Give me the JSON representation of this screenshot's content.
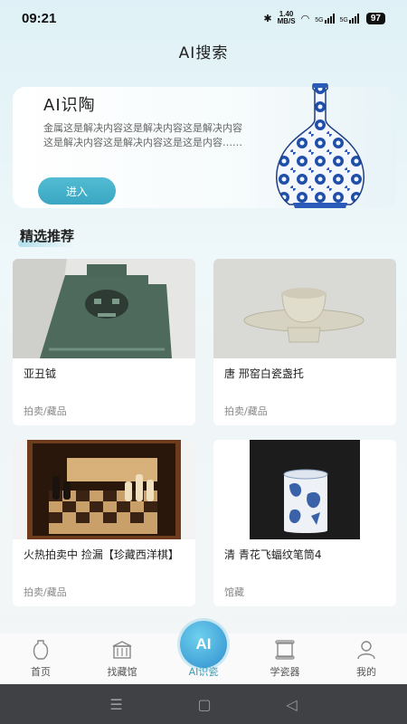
{
  "status": {
    "time": "09:21",
    "speed": "1.40",
    "speed_unit": "MB/S",
    "net1": "5G",
    "net2": "5G",
    "battery": "97"
  },
  "header": {
    "title": "AI搜索"
  },
  "ai_card": {
    "title": "AI识陶",
    "description": "金属这是解决内容这是解决内容这是解决内容这是解决内容这是解决内容这是这是内容……",
    "button": "进入"
  },
  "section": {
    "title": "精选推荐"
  },
  "items": [
    {
      "name": "亚丑钺",
      "tag": "拍卖/藏品",
      "image": "bronze-axe-image"
    },
    {
      "name": "唐 邢窑白瓷盏托",
      "tag": "拍卖/藏品",
      "image": "white-porcelain-cup-image"
    },
    {
      "name": "火热拍卖中 捡漏【珍藏西洋棋】",
      "tag": "拍卖/藏品",
      "image": "chess-set-image"
    },
    {
      "name": "清 青花飞蝠纹笔筒4",
      "tag": "馆藏",
      "image": "blue-white-brush-pot-image"
    }
  ],
  "tabs": [
    {
      "label": "首页",
      "icon": "vase-icon"
    },
    {
      "label": "找藏馆",
      "icon": "museum-icon"
    },
    {
      "label": "AI识瓷",
      "icon": "ai-icon",
      "badge": "AI",
      "active": true
    },
    {
      "label": "学瓷器",
      "icon": "scroll-icon"
    },
    {
      "label": "我的",
      "icon": "user-icon"
    }
  ],
  "colors": {
    "accent": "#3c9ab5",
    "button": "#45b1ca",
    "background": "#e6f3f6"
  }
}
